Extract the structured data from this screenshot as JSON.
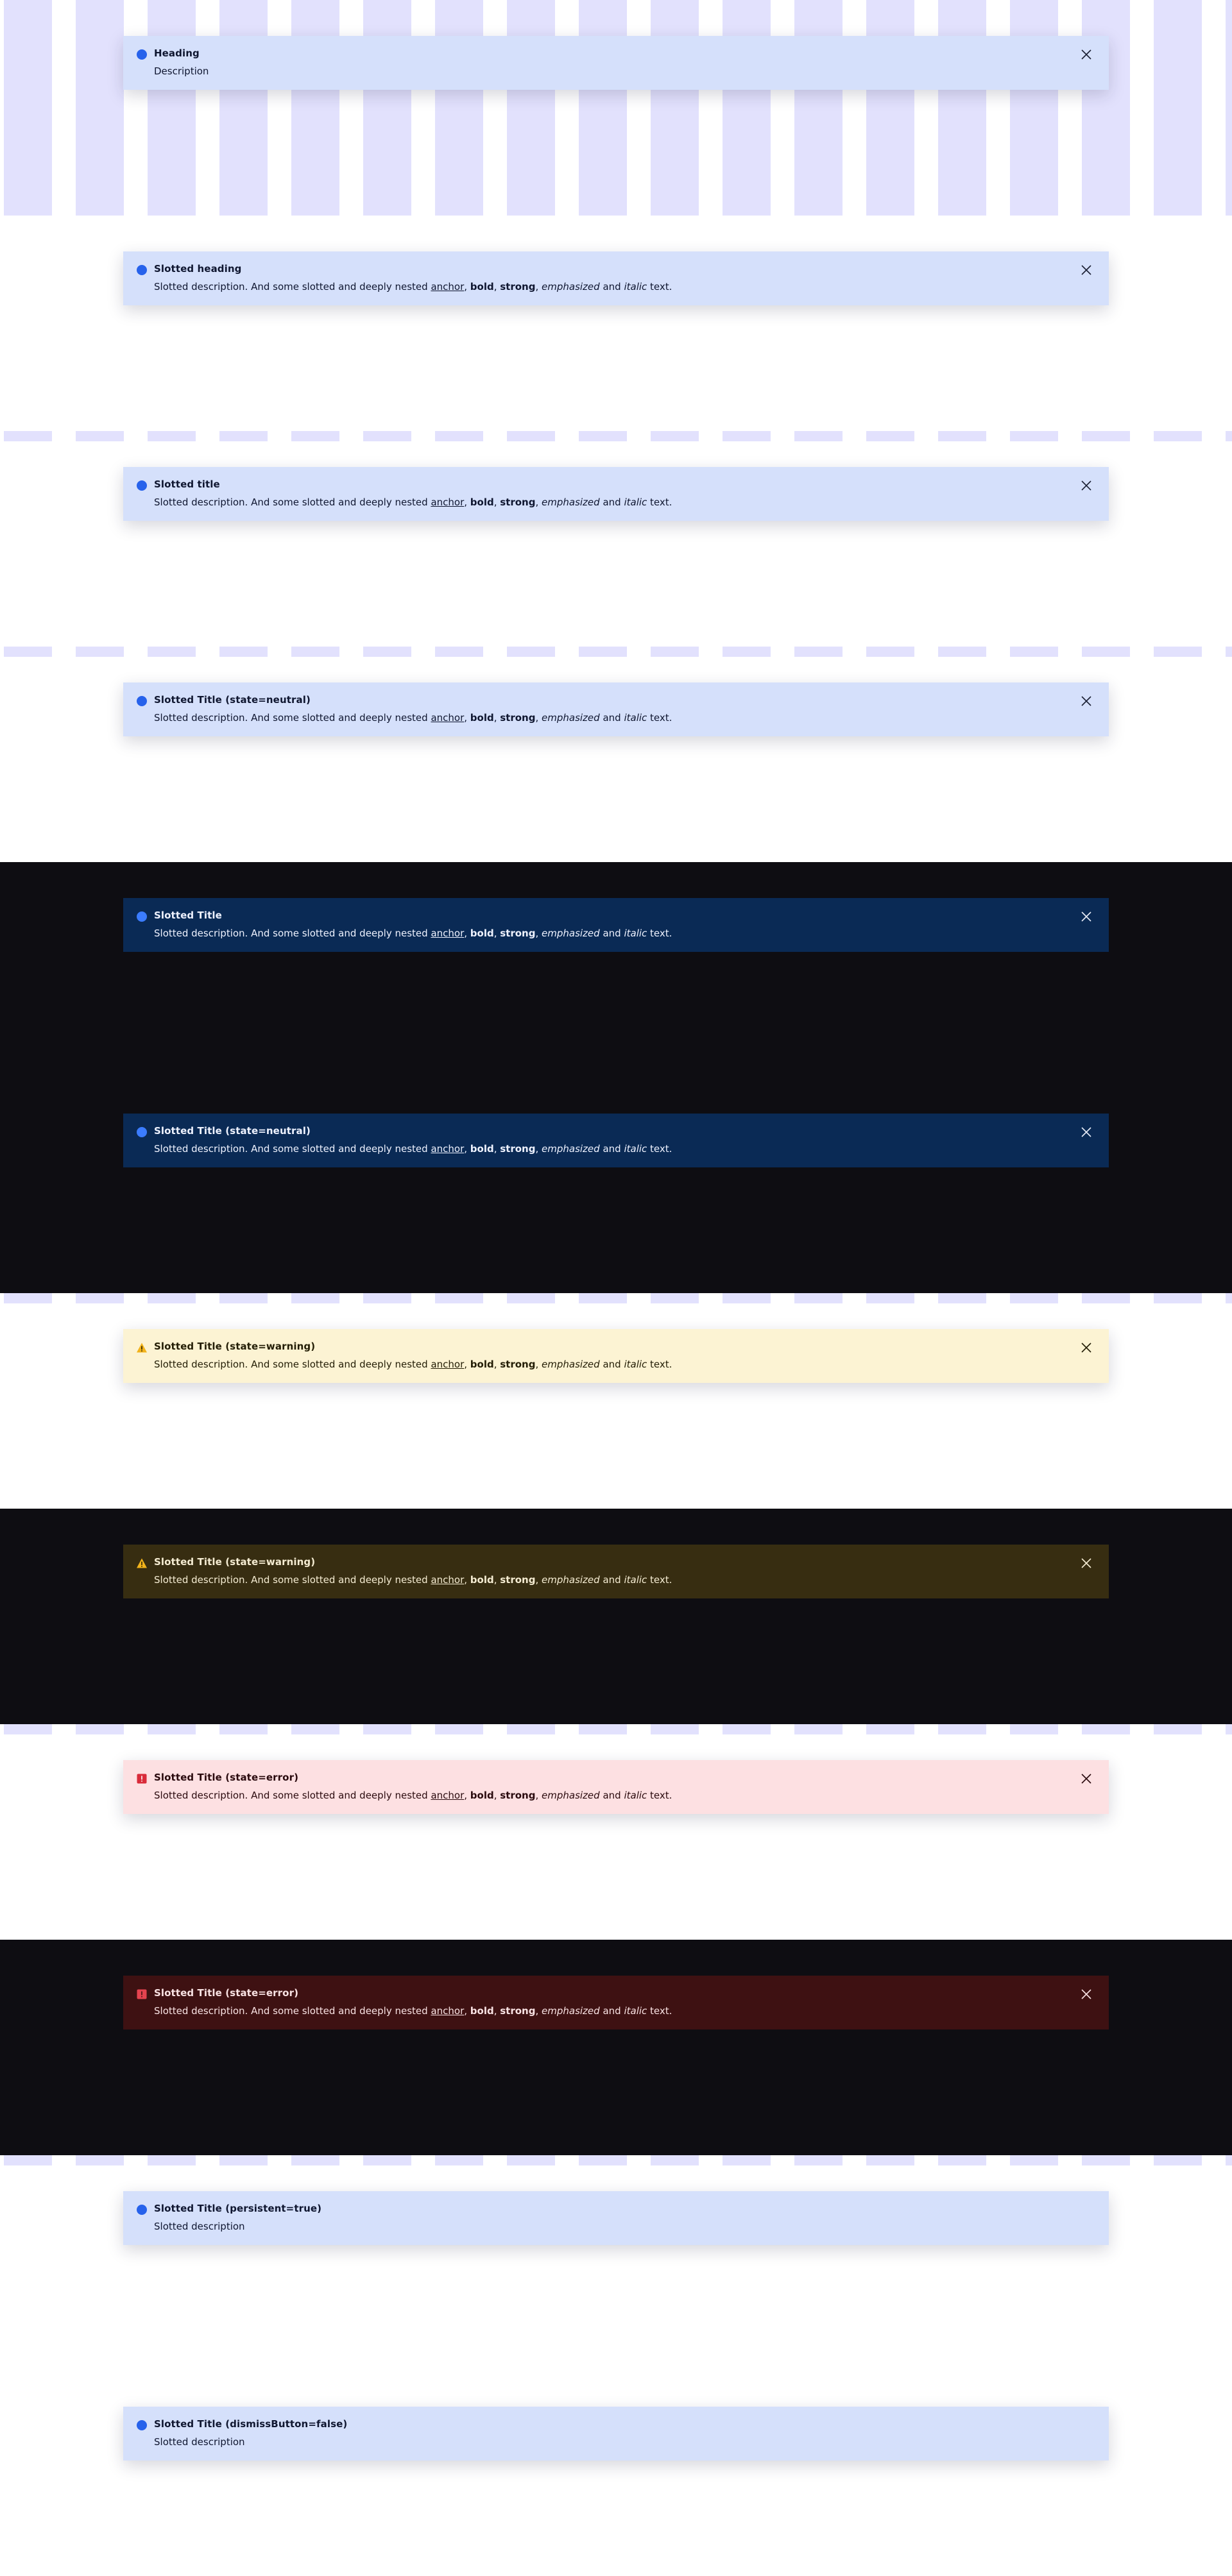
{
  "colors": {
    "stripe": "#e2e1fd",
    "dark_canvas": "#0e0d12",
    "neutral_icon": "#2762eb",
    "warning_icon": "#f2b31b",
    "error_icon": "#d92b3a"
  },
  "close_label": "close-icon",
  "description_parts": {
    "intro": "Slotted description. And some slotted and deeply nested ",
    "anchor": "anchor",
    "comma1": ", ",
    "bold": "bold",
    "comma2": ", ",
    "strong": "strong",
    "comma3": ", ",
    "emphasized": "emphasized",
    "and": " and ",
    "italic": "italic",
    "end": " text."
  },
  "banners": [
    {
      "title": "Heading",
      "description": "Description",
      "state": "neutral",
      "theme": "light"
    },
    {
      "title": "Slotted heading",
      "state": "neutral",
      "theme": "light"
    },
    {
      "title": "Slotted title",
      "state": "neutral",
      "theme": "light"
    },
    {
      "title": "Slotted Title (state=neutral)",
      "state": "neutral",
      "theme": "light"
    },
    {
      "title": "Slotted Title",
      "state": "neutral",
      "theme": "dark"
    },
    {
      "title": "Slotted Title (state=neutral)",
      "state": "neutral",
      "theme": "dark"
    },
    {
      "title": "Slotted Title (state=warning)",
      "state": "warning",
      "theme": "light"
    },
    {
      "title": "Slotted Title (state=warning)",
      "state": "warning",
      "theme": "dark"
    },
    {
      "title": "Slotted Title (state=error)",
      "state": "error",
      "theme": "light"
    },
    {
      "title": "Slotted Title (state=error)",
      "state": "error",
      "theme": "dark"
    },
    {
      "title": "Slotted Title (persistent=true)",
      "description": "Slotted description",
      "state": "neutral",
      "theme": "light"
    },
    {
      "title": "Slotted Title (dismissButton=false)",
      "description": "Slotted description",
      "state": "neutral",
      "theme": "light"
    }
  ]
}
